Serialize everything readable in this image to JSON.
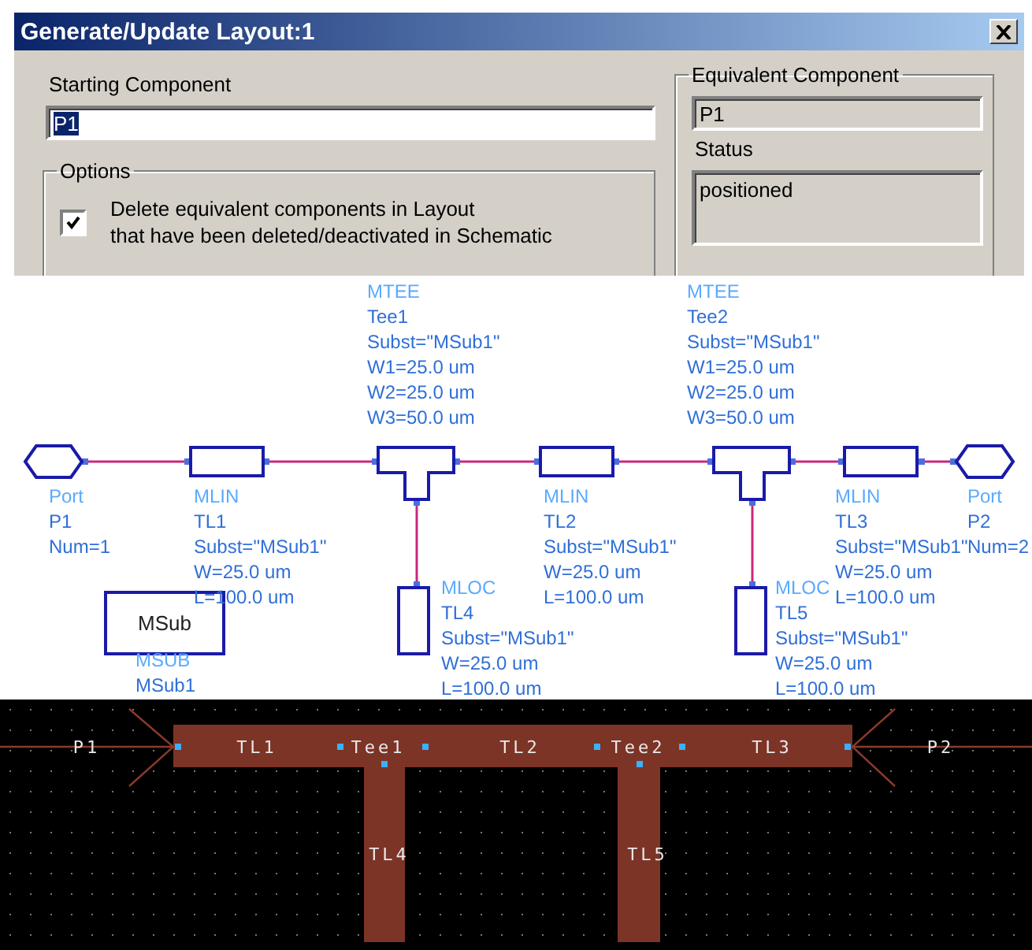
{
  "dialog": {
    "title": "Generate/Update Layout:1",
    "starting_component": {
      "label": "Starting Component",
      "value": "P1",
      "value_selected": true
    },
    "options": {
      "title": "Options",
      "checkbox": {
        "label_lines": [
          "Delete equivalent components in Layout",
          "that have been deleted/deactivated in Schematic"
        ],
        "checked": true
      }
    },
    "equivalent_component": {
      "title": "Equivalent Component",
      "value": "P1",
      "status_label": "Status",
      "status": "positioned"
    }
  },
  "schematic": {
    "components": [
      {
        "kind": "port",
        "label_lines": [
          "Port",
          "P1",
          "Num=1"
        ]
      },
      {
        "kind": "mlin",
        "label_lines": [
          "MLIN",
          "TL1",
          "Subst=\"MSub1\"",
          "W=25.0 um",
          "L=100.0 um"
        ]
      },
      {
        "kind": "mtee",
        "label_lines": [
          "MTEE",
          "Tee1",
          "Subst=\"MSub1\"",
          "W1=25.0 um",
          "W2=25.0 um",
          "W3=50.0 um"
        ]
      },
      {
        "kind": "mlin",
        "label_lines": [
          "MLIN",
          "TL2",
          "Subst=\"MSub1\"",
          "W=25.0 um",
          "L=100.0 um"
        ]
      },
      {
        "kind": "mtee",
        "label_lines": [
          "MTEE",
          "Tee2",
          "Subst=\"MSub1\"",
          "W1=25.0 um",
          "W2=25.0 um",
          "W3=50.0 um"
        ]
      },
      {
        "kind": "mlin",
        "label_lines": [
          "MLIN",
          "TL3",
          "Subst=\"MSub1\"",
          "W=25.0 um",
          "L=100.0 um"
        ]
      },
      {
        "kind": "port",
        "label_lines": [
          "Port",
          "P2",
          "Num=2"
        ]
      },
      {
        "kind": "msub",
        "symbol_text": "MSub",
        "label_lines": [
          "MSUB",
          "MSub1"
        ]
      },
      {
        "kind": "mloc",
        "label_lines": [
          "MLOC",
          "TL4",
          "Subst=\"MSub1\"",
          "W=25.0 um",
          "L=100.0 um"
        ]
      },
      {
        "kind": "mloc",
        "label_lines": [
          "MLOC",
          "TL5",
          "Subst=\"MSub1\"",
          "W=25.0 um",
          "L=100.0 um"
        ]
      }
    ]
  },
  "layout": {
    "labels": [
      "P1",
      "TL1",
      "Tee1",
      "TL2",
      "Tee2",
      "TL3",
      "P2",
      "TL4",
      "TL5"
    ]
  }
}
